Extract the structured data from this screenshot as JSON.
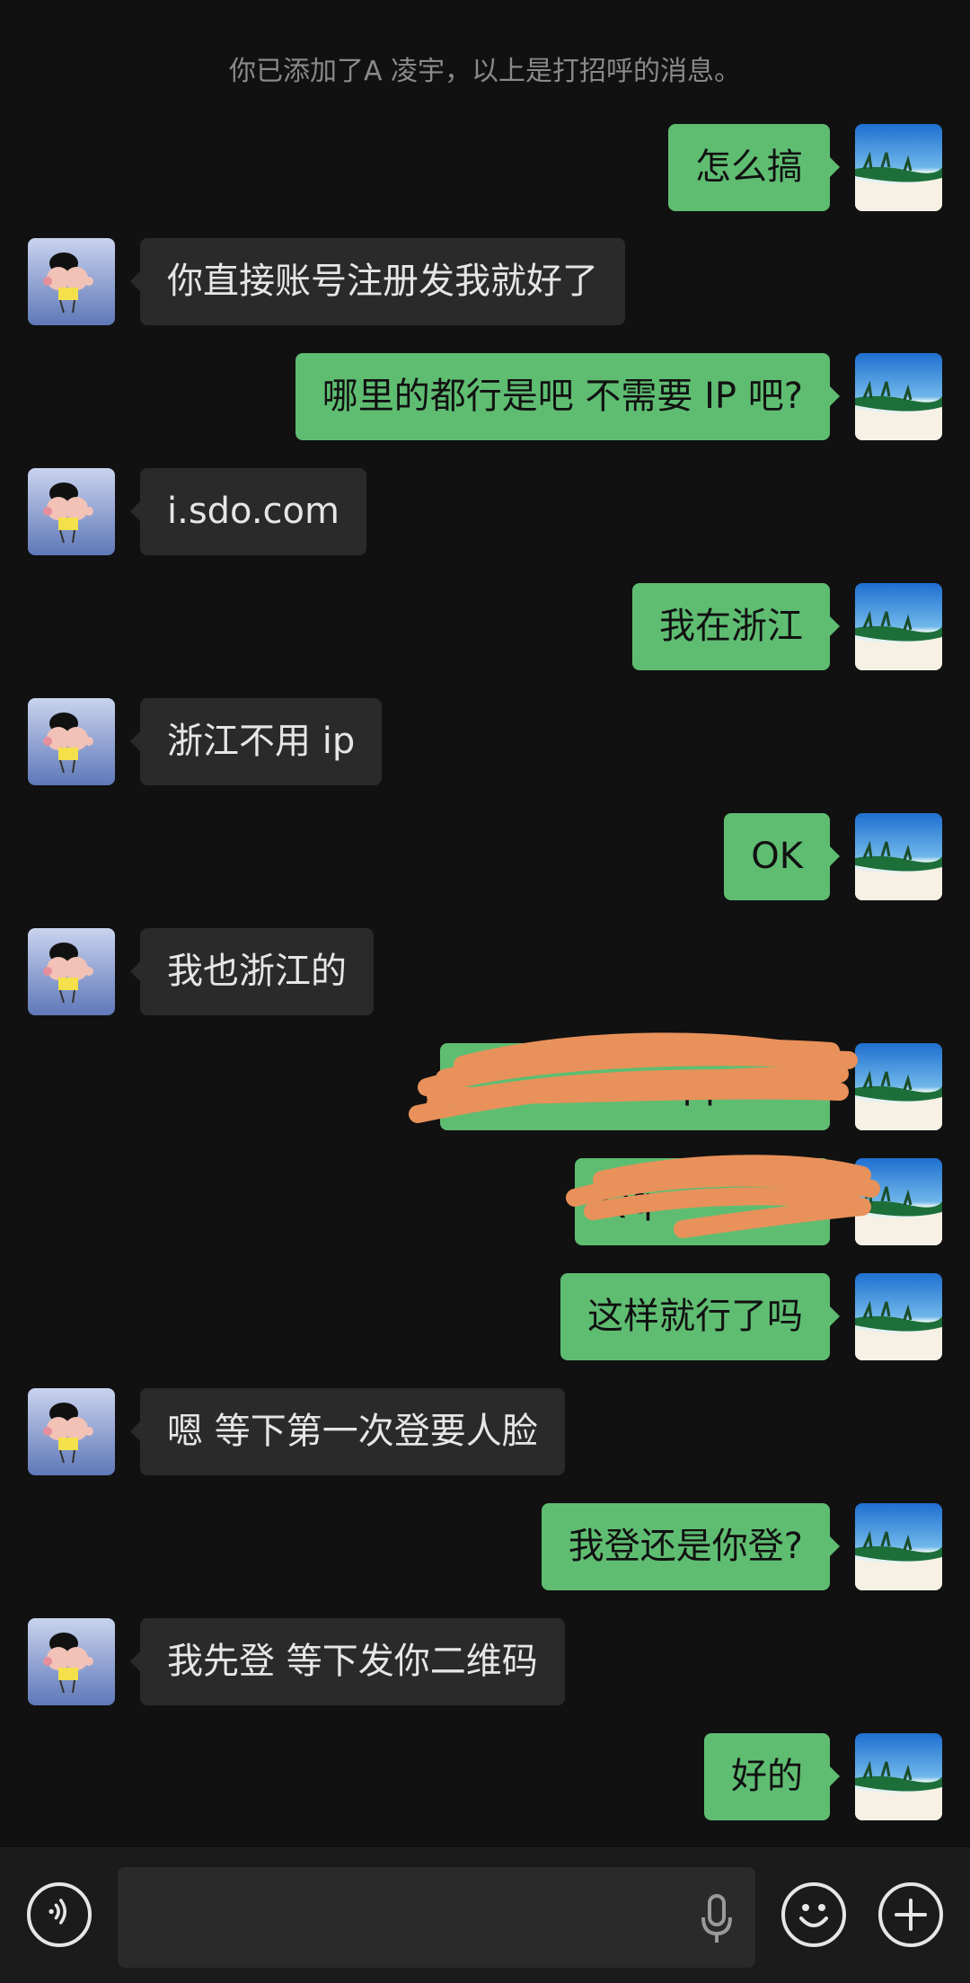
{
  "system_message": "你已添加了A 凌宇，以上是打招呼的消息。",
  "messages": [
    {
      "side": "out",
      "text": "怎么搞"
    },
    {
      "side": "in",
      "text": "你直接账号注册发我就好了"
    },
    {
      "side": "out",
      "text": "哪里的都行是吧  不需要 IP 吧?"
    },
    {
      "side": "in",
      "text": "i.sdo.com"
    },
    {
      "side": "out",
      "text": "我在浙江"
    },
    {
      "side": "in",
      "text": "浙江不用 ip"
    },
    {
      "side": "out",
      "text": "OK"
    },
    {
      "side": "in",
      "text": "我也浙江的"
    },
    {
      "side": "out",
      "text": "qq.com"
    },
    {
      "side": "out",
      "text": "Qq"
    },
    {
      "side": "out",
      "text": "这样就行了吗"
    },
    {
      "side": "in",
      "text": "嗯 等下第一次登要人脸"
    },
    {
      "side": "out",
      "text": "我登还是你登?"
    },
    {
      "side": "in",
      "text": "我先登 等下发你二维码"
    },
    {
      "side": "out",
      "text": "好的"
    }
  ],
  "input_bar": {
    "voice_icon": "voice-mode-icon",
    "mic_icon": "microphone-icon",
    "emoji_icon": "emoji-icon",
    "more_icon": "plus-icon",
    "input_value": ""
  },
  "colors": {
    "outgoing": "#5fbd72",
    "incoming": "#2a2a2a",
    "background": "#111111",
    "scribble": "#e8915a"
  }
}
